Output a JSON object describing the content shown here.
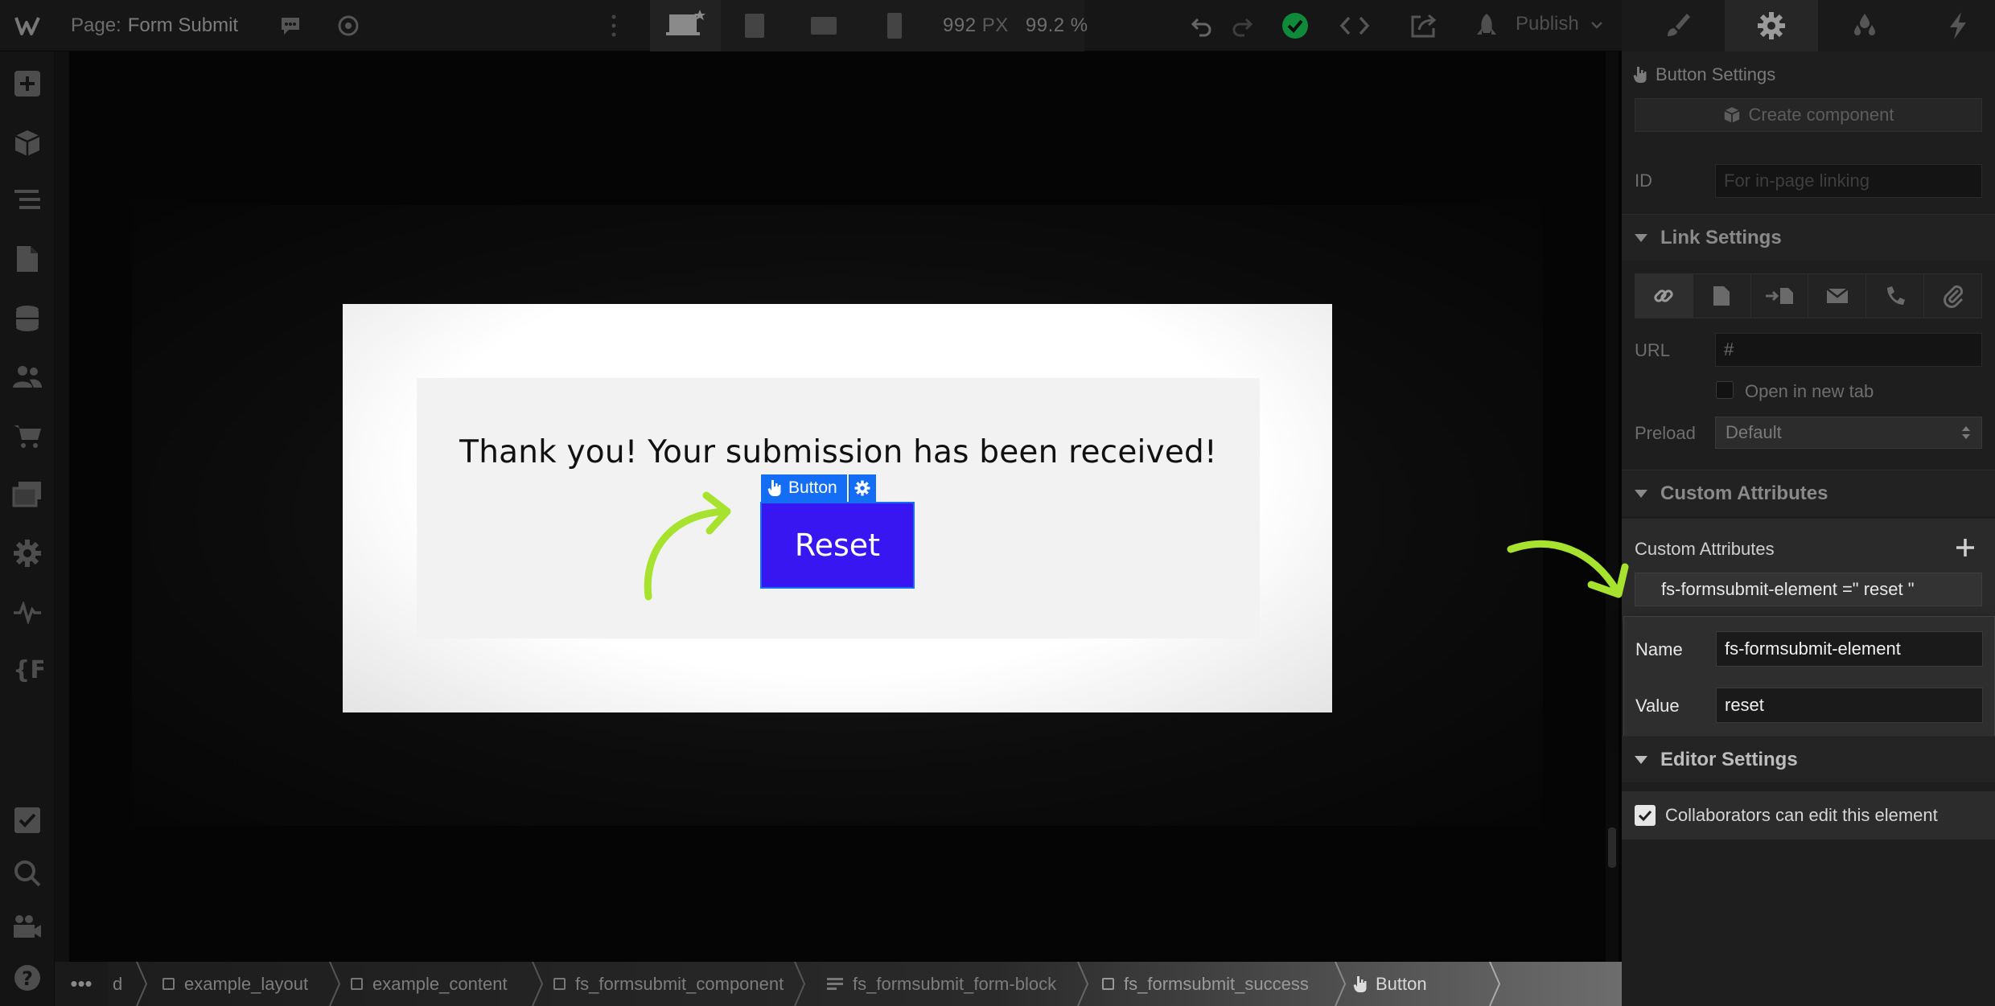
{
  "topbar": {
    "page_prefix": "Page:",
    "page_name": "Form Submit",
    "viewport_width": "992",
    "viewport_unit": "PX",
    "zoom": "99.2",
    "zoom_unit": "%",
    "publish_label": "Publish"
  },
  "canvas": {
    "thanks_text": "Thank you! Your submission has been received!",
    "element_tag_label": "Button",
    "reset_button_label": "Reset",
    "accent_color": "#146ef5",
    "button_color": "#3716f2",
    "annotation_color": "#a6e22e"
  },
  "breadcrumb": {
    "more": "•••",
    "items": [
      {
        "label": "d"
      },
      {
        "label": "example_layout"
      },
      {
        "label": "example_content"
      },
      {
        "label": "fs_formsubmit_component"
      },
      {
        "label": "fs_formsubmit_form-block"
      },
      {
        "label": "fs_formsubmit_success"
      },
      {
        "label": "Button"
      }
    ]
  },
  "panel": {
    "header": "Button Settings",
    "create_component": "Create component",
    "id_label": "ID",
    "id_placeholder": "For in-page linking",
    "link_settings_title": "Link Settings",
    "url_label": "URL",
    "url_value": "#",
    "open_new_tab": "Open in new tab",
    "preload_label": "Preload",
    "preload_value": "Default",
    "custom_attributes_title": "Custom Attributes",
    "custom_attributes_label": "Custom Attributes",
    "attribute_summary": "fs-formsubmit-element =\" reset \"",
    "name_label": "Name",
    "name_value": "fs-formsubmit-element",
    "value_label": "Value",
    "value_value": "reset",
    "editor_settings_title": "Editor Settings",
    "collaborators_label": "Collaborators can edit this element",
    "collaborators_checked": true
  },
  "icons": {
    "left_toolbar": [
      "add-icon",
      "components-icon",
      "navigator-icon",
      "pages-icon",
      "cms-icon",
      "users-icon",
      "ecommerce-icon",
      "assets-icon",
      "settings-icon",
      "audit-icon",
      "variables-icon",
      "checklist-icon",
      "search-icon",
      "video-icon",
      "help-icon"
    ],
    "panel_tabs": [
      "style-brush-icon",
      "settings-gear-icon",
      "interactions-drops-icon",
      "lightning-icon"
    ],
    "link_types": [
      "url-link-icon",
      "page-icon",
      "section-icon",
      "email-icon",
      "phone-icon",
      "file-attachment-icon"
    ]
  }
}
